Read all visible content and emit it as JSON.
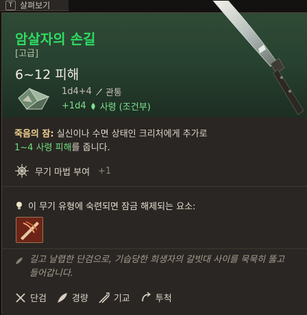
{
  "topbar": {
    "key": "T",
    "label": "살펴보기"
  },
  "item": {
    "name": "암살자의 손길",
    "rarity": "[고급]",
    "damage": "6~12 피해",
    "damage_line1": {
      "dice": "1d4+4",
      "type": "관통"
    },
    "damage_line2": {
      "dice": "+1d4",
      "type": "사령 (조건부)"
    }
  },
  "passive": {
    "name": "죽음의 잠:",
    "text_part1": " 실신이나 수면 상태인 크리처에게 추가로",
    "damage": "1~4 사령 피해",
    "text_part2": "를 줍니다."
  },
  "enchant": {
    "label": "무기 마법 부여",
    "value": "+1"
  },
  "proficiency": {
    "text": "이 무기 유형에 숙련되면 잠금 해제되는 요소:"
  },
  "flavor": {
    "text": "길고 날렵한 단검으로, 기습당한 희생자의 갈빗대 사이를 묵묵히 뚫고 들어갑니다."
  },
  "properties": [
    {
      "label": "단검",
      "icon": "dagger-icon"
    },
    {
      "label": "경량",
      "icon": "feather-icon"
    },
    {
      "label": "기교",
      "icon": "finesse-icon"
    },
    {
      "label": "투척",
      "icon": "thrown-icon"
    }
  ],
  "colors": {
    "title": "#2fdc63",
    "header_bg": "#2f4a35",
    "necrotic": "#7fe08f",
    "passive_name": "#f1d38f"
  }
}
